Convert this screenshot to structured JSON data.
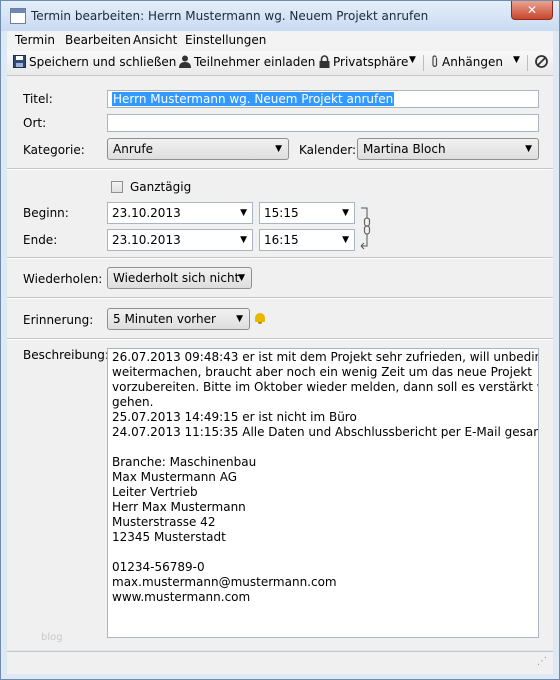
{
  "window": {
    "title": "Termin bearbeiten: Herrn Mustermann wg. Neuem Projekt anrufen",
    "close_glyph": "✕"
  },
  "menu": {
    "items": [
      "Termin",
      "Bearbeiten",
      "Ansicht",
      "Einstellungen"
    ]
  },
  "toolbar": {
    "save_close": "Speichern und schließen",
    "invite": "Teilnehmer einladen",
    "privacy": "Privatsphäre",
    "attach": "Anhängen"
  },
  "form": {
    "title_label": "Titel:",
    "title_value": "Herrn Mustermann wg. Neuem Projekt anrufen",
    "location_label": "Ort:",
    "location_value": "",
    "category_label": "Kategorie:",
    "category_value": "Anrufe",
    "calendar_label": "Kalender:",
    "calendar_value": "Martina Bloch",
    "allday_label": "Ganztägig",
    "allday_checked": false,
    "begin_label": "Beginn:",
    "begin_date": "23.10.2013",
    "begin_time": "15:15",
    "end_label": "Ende:",
    "end_date": "23.10.2013",
    "end_time": "16:15",
    "repeat_label": "Wiederholen:",
    "repeat_value": "Wiederholt sich nicht",
    "reminder_label": "Erinnerung:",
    "reminder_value": "5 Minuten vorher",
    "description_label": "Beschreibung:",
    "description_lines": [
      "26.07.2013 09:48:43 er ist mit dem Projekt sehr zufrieden, will unbedingt",
      "weitermachen, braucht aber noch ein wenig Zeit um das neue Projekt",
      "vorzubereiten. Bitte im Oktober wieder melden, dann soll es verstärkt weiter",
      "gehen.",
      "25.07.2013 14:49:15 er ist nicht im Büro",
      "24.07.2013 11:15:35 Alle Daten und Abschlussbericht per E-Mail gesandt",
      "",
      "Branche: Maschinenbau",
      "Max Mustermann AG",
      "Leiter Vertrieb",
      "Herr Max Mustermann",
      "Musterstrasse 42",
      "12345 Musterstadt",
      "",
      "01234-56789-0",
      "max.mustermann@mustermann.com",
      "www.mustermann.com"
    ]
  },
  "watermark": "blog",
  "colors": {
    "selection": "#3399ff",
    "window_border": "#6e8bb0",
    "close_red": "#c9452c"
  }
}
